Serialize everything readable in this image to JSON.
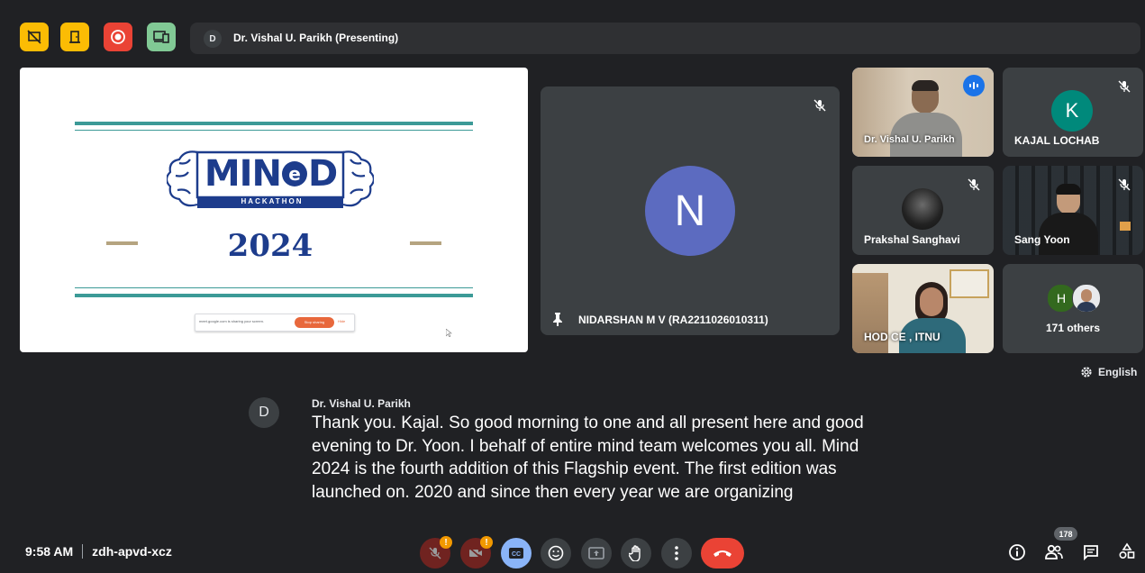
{
  "top_bar": {
    "presenter_initial": "D",
    "presenter_text": "Dr. Vishal U. Parikh (Presenting)"
  },
  "slide": {
    "title_left": "MIN",
    "title_e": "e",
    "title_right": "D",
    "subtitle": "HACKATHON",
    "year": "2024",
    "share_bar_text": "meet.google.com is sharing your screen.",
    "stop_sharing_label": "Stop sharing",
    "hide_label": "Hide"
  },
  "main_tile": {
    "avatar_letter": "N",
    "name": "NIDARSHAN M V (RA2211026010311)"
  },
  "grid": {
    "vishal": {
      "name": "Dr. Vishal U. Parikh"
    },
    "kajal": {
      "avatar_letter": "K",
      "name": "KAJAL LOCHAB"
    },
    "prakshal": {
      "name": "Prakshal Sanghavi"
    },
    "sang": {
      "name": "Sang Yoon"
    },
    "hod": {
      "name": "HOD CE , ITNU"
    },
    "others": {
      "avatar_letter": "H",
      "label": "171 others"
    }
  },
  "captions": {
    "language": "English",
    "speaker_initial": "D",
    "speaker_name": "Dr. Vishal U. Parikh",
    "line1": "Thank you. Kajal. So good morning to one and all present here and good",
    "line2": "evening to Dr. Yoon. I behalf of entire mind team welcomes you all. Mind",
    "line3": "2024 is the fourth addition of this Flagship event. The first edition was",
    "line4": "launched on. 2020 and since then every year we are organizing"
  },
  "bottom_bar": {
    "time": "9:58 AM",
    "meeting_code": "zdh-apvd-xcz",
    "people_count": "178",
    "alert_badge": "!"
  },
  "colors": {
    "background": "#202124",
    "tile": "#3c4043",
    "accent_blue": "#8ab4f8",
    "end_call_red": "#ea4335",
    "warning_orange": "#f29900",
    "avatar_n": "#5c6bc0",
    "avatar_k": "#00897b",
    "slide_navy": "#1d3c8c",
    "slide_teal": "#3c9a97"
  }
}
